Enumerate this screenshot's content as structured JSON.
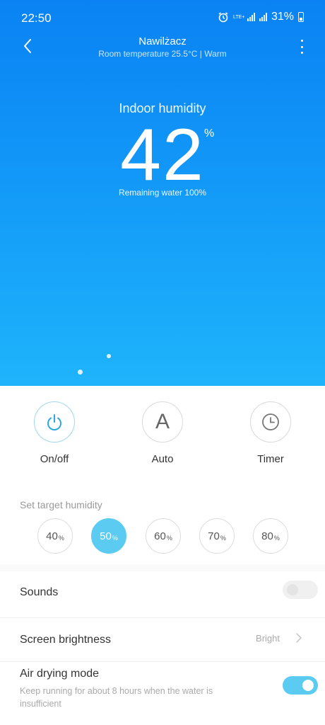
{
  "status_bar": {
    "time": "22:50",
    "network": "LTE+",
    "battery": "31%"
  },
  "header": {
    "title": "Nawilżacz",
    "subtitle": "Room temperature 25.5°C | Warm"
  },
  "hero": {
    "humidity_label": "Indoor humidity",
    "humidity_value": "42",
    "humidity_unit": "%",
    "remaining_water": "Remaining water 100%"
  },
  "controls": [
    {
      "label": "On/off",
      "icon": "power-icon",
      "active": true
    },
    {
      "label": "Auto",
      "icon": "auto-icon",
      "letter": "A",
      "active": false
    },
    {
      "label": "Timer",
      "icon": "clock-icon",
      "active": false
    }
  ],
  "target_humidity": {
    "label": "Set target humidity",
    "options": [
      {
        "value": "40",
        "unit": "%"
      },
      {
        "value": "50",
        "unit": "%"
      },
      {
        "value": "60",
        "unit": "%"
      },
      {
        "value": "70",
        "unit": "%"
      },
      {
        "value": "80",
        "unit": "%"
      }
    ],
    "selected": "50"
  },
  "settings": {
    "sounds": {
      "title": "Sounds",
      "enabled": false
    },
    "brightness": {
      "title": "Screen brightness",
      "value": "Bright"
    },
    "air_drying": {
      "title": "Air drying mode",
      "description": "Keep running for about 8 hours when the water is insufficient",
      "enabled": true
    }
  },
  "colors": {
    "hero_top": "#0a82f3",
    "hero_bottom": "#1eb4fb",
    "accent": "#5ccbf2"
  }
}
